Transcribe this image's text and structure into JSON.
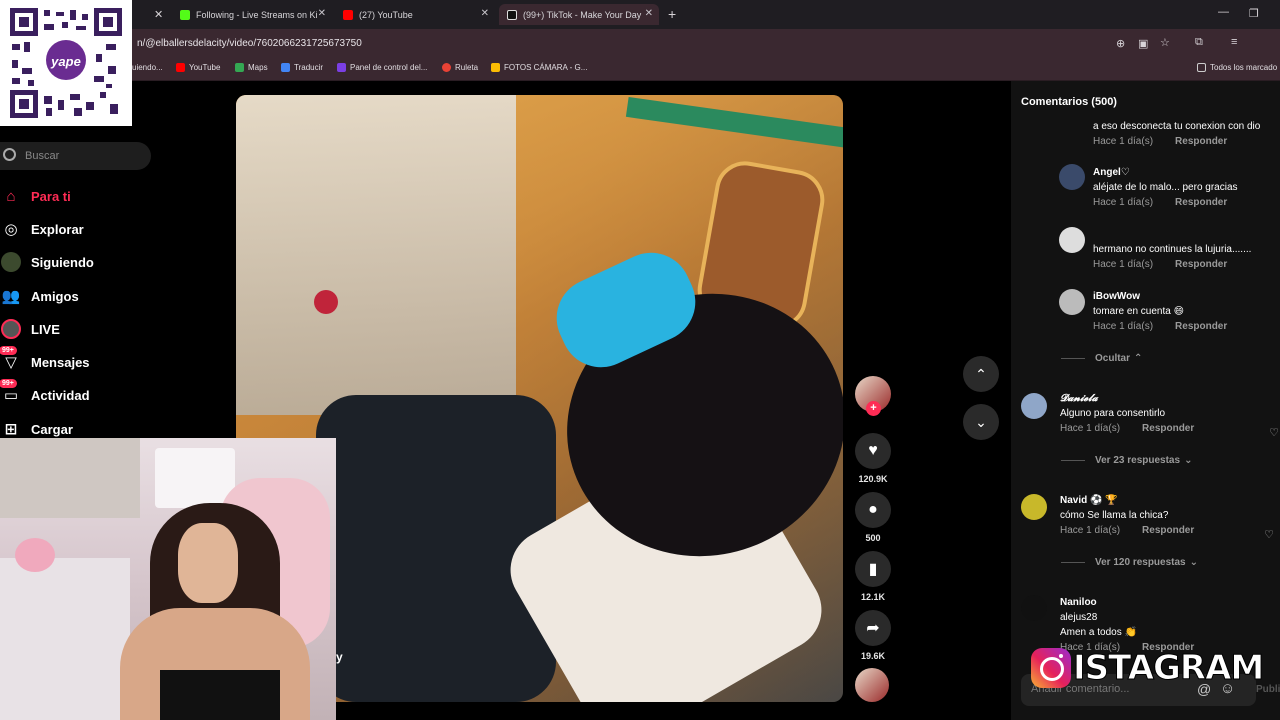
{
  "browser": {
    "tabs": [
      {
        "label": "Following - Live Streams on Ki",
        "color": "#53fc18"
      },
      {
        "label": "(27) YouTube",
        "color": "#ff0000"
      },
      {
        "label": "(99+) TikTok - Make Your Day",
        "color": "#000000"
      }
    ],
    "url": "n/@elballersdelacity/video/7602066231725673750",
    "bookmarks": [
      {
        "label": "uiendo...",
        "color": "#888888"
      },
      {
        "label": "YouTube",
        "color": "#ff0000"
      },
      {
        "label": "Maps",
        "color": "#34a853"
      },
      {
        "label": "Traducir",
        "color": "#4285f4"
      },
      {
        "label": "Panel de control del...",
        "color": "#7b3fe4"
      },
      {
        "label": "Ruleta",
        "color": "#e94235"
      },
      {
        "label": "FOTOS CÁMARA - G...",
        "color": "#fbbc04"
      }
    ],
    "all_bookmarks": "Todos los marcado"
  },
  "qr": {
    "brand": "yape"
  },
  "sidebar": {
    "search_placeholder": "Buscar",
    "items": [
      {
        "label": "Para ti",
        "icon": "home-icon"
      },
      {
        "label": "Explorar",
        "icon": "compass-icon"
      },
      {
        "label": "Siguiendo",
        "icon": "following-icon"
      },
      {
        "label": "Amigos",
        "icon": "friends-icon"
      },
      {
        "label": "LIVE",
        "icon": "live-icon"
      },
      {
        "label": "Mensajes",
        "icon": "message-icon",
        "badge": "99+"
      },
      {
        "label": "Actividad",
        "icon": "activity-icon",
        "badge": "99+"
      },
      {
        "label": "Cargar",
        "icon": "upload-icon"
      }
    ]
  },
  "video": {
    "caption_fragment": "y"
  },
  "actions": {
    "likes": "120.9K",
    "comments": "500",
    "saves": "12.1K",
    "shares": "19.6K"
  },
  "comments": {
    "header": "Comentarios (500)",
    "items": [
      {
        "name": "",
        "text": "a eso desconecta tu conexion con dio",
        "time": "Hace 1 día(s)",
        "reply": "Responder"
      },
      {
        "name": "Angel♡",
        "text": "aléjate de lo malo... pero gracias",
        "time": "Hace 1 día(s)",
        "reply": "Responder"
      },
      {
        "name": "",
        "text": "hermano no continues la lujuria.......",
        "time": "Hace 1 día(s)",
        "reply": "Responder"
      },
      {
        "name": "iBowWow",
        "text": "tomare en cuenta 😄",
        "time": "Hace 1 día(s)",
        "reply": "Responder"
      },
      {
        "name": "𝓓𝓪𝓷𝓲𝓮𝓵𝓪",
        "text": "Alguno para consentirlo",
        "time": "Hace 1 día(s)",
        "reply": "Responder"
      },
      {
        "name": "Navid ⚽ 🏆",
        "text": "cómo Se llama la chica?",
        "time": "Hace 1 día(s)",
        "reply": "Responder"
      },
      {
        "name": "Naniloo",
        "text": "alejus28",
        "text2": "Amen a todos 👏",
        "time": "Hace 1 día(s)",
        "reply": "Responder"
      }
    ],
    "hide_label": "Ocultar",
    "more_1": "Ver 23 respuestas",
    "more_2": "Ver 120 respuestas",
    "add_placeholder": "Añadir comentario...",
    "post_label": "Publi"
  },
  "overlay": {
    "instagram_word": "ISTAGRAM"
  }
}
